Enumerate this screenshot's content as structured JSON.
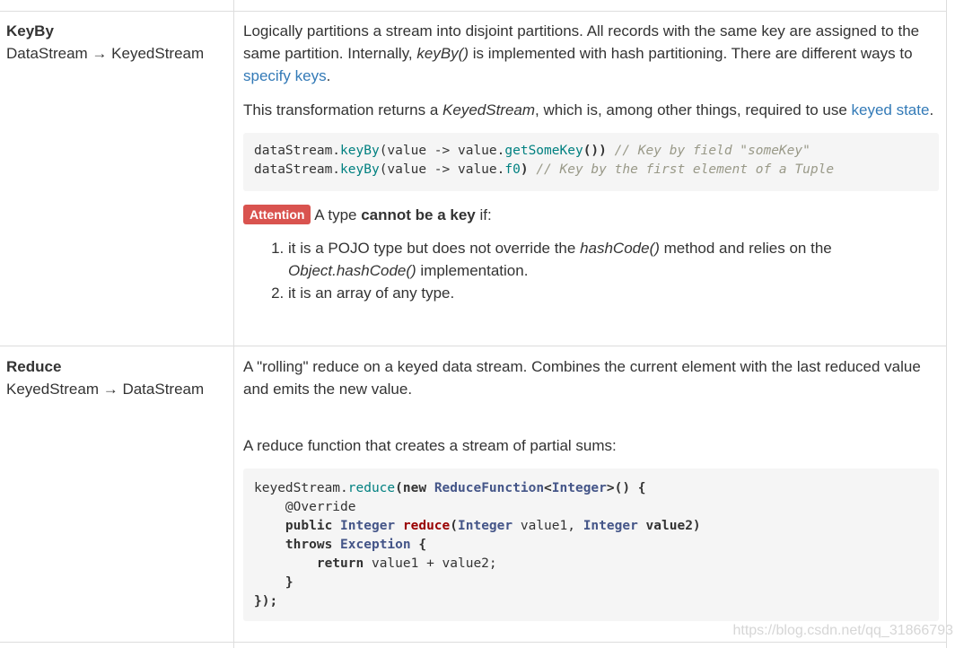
{
  "rows": [
    {
      "name": "KeyBy",
      "signature": "DataStream → KeyedStream",
      "desc_pre": "Logically partitions a stream into disjoint partitions. All records with the same key are assigned to the same partition. Internally, ",
      "desc_em": "keyBy()",
      "desc_mid": " is implemented with hash partitioning. There are different ways to ",
      "desc_link": "specify keys",
      "desc_post": ".",
      "p2_pre": "This transformation returns a ",
      "p2_em": "KeyedStream",
      "p2_mid": ", which is, among other things, required to use ",
      "p2_link": "keyed state",
      "p2_post": ".",
      "code": {
        "line1": {
          "obj": "dataStream.",
          "fn": "keyBy",
          "p1": "(value -> value.",
          "fn2": "getSomeKey",
          "p2": "()) ",
          "comment": "// Key by field \"someKey\""
        },
        "line2": {
          "obj": "dataStream.",
          "fn": "keyBy",
          "p1": "(value -> value.",
          "fn2": "f0",
          "p2": ") ",
          "comment": "// Key by the first element of a Tuple"
        }
      },
      "attention_badge": "Attention",
      "attention_pre": " A type ",
      "attention_bold": "cannot be a key",
      "attention_post": " if:",
      "list": [
        {
          "pre": "it is a POJO type but does not override the ",
          "em1": "hashCode()",
          "mid": " method and relies on the ",
          "em2": "Object.hashCode()",
          "post": " implementation."
        },
        {
          "text": "it is an array of any type."
        }
      ]
    },
    {
      "name": "Reduce",
      "signature": "KeyedStream → DataStream",
      "desc": "A \"rolling\" reduce on a keyed data stream. Combines the current element with the last reduced value and emits the new value.",
      "p2": "A reduce function that creates a stream of partial sums:",
      "code": {
        "l1_obj": "keyedStream.",
        "l1_fn": "reduce",
        "l1_paren": "(",
        "l1_new": "new",
        "l1_type": "ReduceFunction",
        "l1_lt": "<",
        "l1_int": "Integer",
        "l1_end": ">() {",
        "l2": "@Override",
        "l3_public": "public",
        "l3_int": "Integer",
        "l3_fn": "reduce",
        "l3_p": "(",
        "l3_int2": "Integer",
        "l3_v1": " value1, ",
        "l3_int3": "Integer",
        "l3_v2": " value2)",
        "l4_throws": "throws",
        "l4_exc": "Exception",
        "l4_brace": " {",
        "l5_return": "return",
        "l5_expr": " value1 + value2;",
        "l6": "}",
        "l7": "});"
      }
    }
  ],
  "watermark": "https://blog.csdn.net/qq_31866793"
}
